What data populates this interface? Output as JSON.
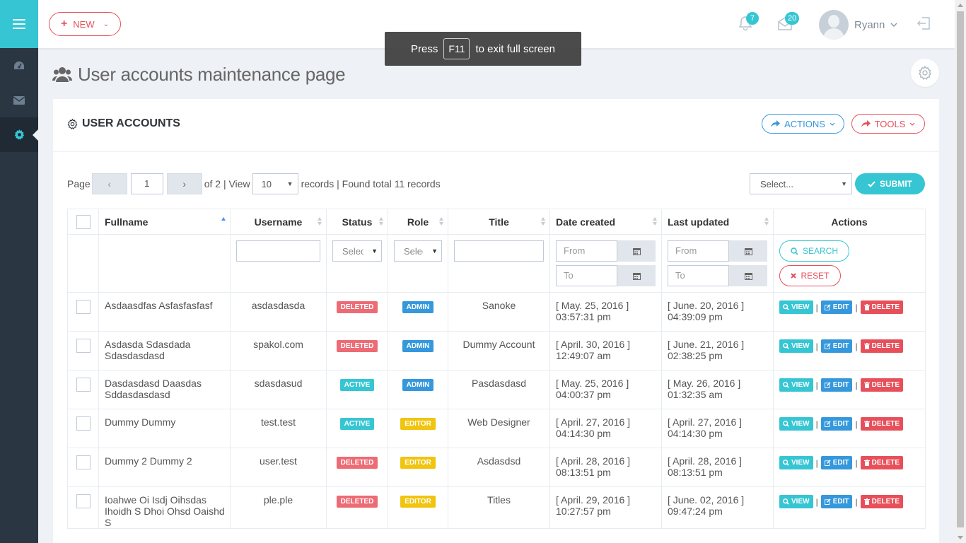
{
  "header": {
    "new_label": "NEW",
    "notifications_count": "7",
    "messages_count": "20",
    "user_name": "Ryann"
  },
  "toast": {
    "press": "Press",
    "key": "F11",
    "rest": "to exit full screen"
  },
  "page_title": "User accounts maintenance page",
  "portlet": {
    "title": "USER ACCOUNTS",
    "actions_label": "ACTIONS",
    "tools_label": "TOOLS"
  },
  "pager": {
    "page_label": "Page",
    "prev": "‹",
    "next": "›",
    "current_page": "1",
    "of_text": "of 2 | View",
    "per_page": "10",
    "records_text": "records | Found total 11 records"
  },
  "bulk": {
    "select_value": "Select...",
    "submit_label": "SUBMIT"
  },
  "table": {
    "columns": [
      "Fullname",
      "Username",
      "Status",
      "Role",
      "Title",
      "Date created",
      "Last updated",
      "Actions"
    ],
    "filters": {
      "status_placeholder": "Select...",
      "role_placeholder": "Select...",
      "from": "From",
      "to": "To",
      "search_label": "SEARCH",
      "reset_label": "RESET"
    },
    "action_labels": {
      "view": "VIEW",
      "edit": "EDIT",
      "delete": "DELETE",
      "sep": "|"
    },
    "rows": [
      {
        "fullname": "Asdaasdfas Asfasfasfasf",
        "username": "asdasdasda",
        "status": "DELETED",
        "role": "ADMIN",
        "title": "Sanoke",
        "created_date": "[ May. 25, 2016 ]",
        "created_time": "03:57:31 pm",
        "updated_date": "[ June. 20, 2016 ]",
        "updated_time": "04:39:09 pm"
      },
      {
        "fullname": "Asdasda Sdasdada Sdasdasdasd",
        "username": "spakol.com",
        "status": "DELETED",
        "role": "ADMIN",
        "title": "Dummy Account",
        "created_date": "[ April. 30, 2016 ]",
        "created_time": "12:49:07 am",
        "updated_date": "[ June. 21, 2016 ]",
        "updated_time": "02:38:25 pm"
      },
      {
        "fullname": "Dasdasdasd Daasdas Sddasdasdasd",
        "username": "sdasdasud",
        "status": "ACTIVE",
        "role": "ADMIN",
        "title": "Pasdasdasd",
        "created_date": "[ May. 25, 2016 ]",
        "created_time": "04:00:37 pm",
        "updated_date": "[ May. 26, 2016 ]",
        "updated_time": "01:32:35 am"
      },
      {
        "fullname": "Dummy Dummy",
        "username": "test.test",
        "status": "ACTIVE",
        "role": "EDITOR",
        "title": "Web Designer",
        "created_date": "[ April. 27, 2016 ]",
        "created_time": "04:14:30 pm",
        "updated_date": "[ April. 27, 2016 ]",
        "updated_time": "04:14:30 pm"
      },
      {
        "fullname": "Dummy 2 Dummy 2",
        "username": "user.test",
        "status": "DELETED",
        "role": "EDITOR",
        "title": "Asdasdsd",
        "created_date": "[ April. 28, 2016 ]",
        "created_time": "08:13:51 pm",
        "updated_date": "[ April. 28, 2016 ]",
        "updated_time": "08:13:51 pm"
      },
      {
        "fullname": "Ioahwe Oi Isdj Oihsdas Ihoidh S Dhoi Ohsd Oaishd S",
        "username": "ple.ple",
        "status": "DELETED",
        "role": "EDITOR",
        "title": "Titles",
        "created_date": "[ April. 29, 2016 ]",
        "created_time": "10:27:57 pm",
        "updated_date": "[ June. 02, 2016 ]",
        "updated_time": "09:47:24 pm"
      }
    ]
  },
  "colors": {
    "accent": "#36c6d3",
    "danger": "#e7505a",
    "primary": "#3598dc",
    "warning": "#f1c40f",
    "sidebar": "#2b3643"
  }
}
